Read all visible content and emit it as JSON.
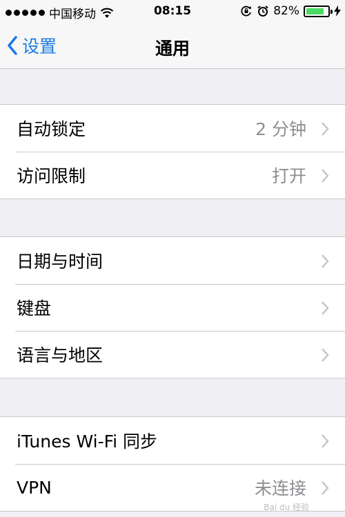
{
  "status_bar": {
    "carrier": "中国移动",
    "time": "08:15",
    "battery_percent": "82%",
    "battery_level": 0.82,
    "battery_color": "#4cd964"
  },
  "nav": {
    "back_label": "设置",
    "title": "通用",
    "accent_color": "#1a7ae0"
  },
  "groups": [
    {
      "rows": [
        {
          "label": "自动锁定",
          "value": "2 分钟"
        },
        {
          "label": "访问限制",
          "value": "打开"
        }
      ]
    },
    {
      "rows": [
        {
          "label": "日期与时间",
          "value": ""
        },
        {
          "label": "键盘",
          "value": ""
        },
        {
          "label": "语言与地区",
          "value": ""
        }
      ]
    },
    {
      "rows": [
        {
          "label": "iTunes Wi-Fi 同步",
          "value": ""
        },
        {
          "label": "VPN",
          "value": "未连接"
        }
      ]
    }
  ],
  "watermark": "Bai du 经验"
}
